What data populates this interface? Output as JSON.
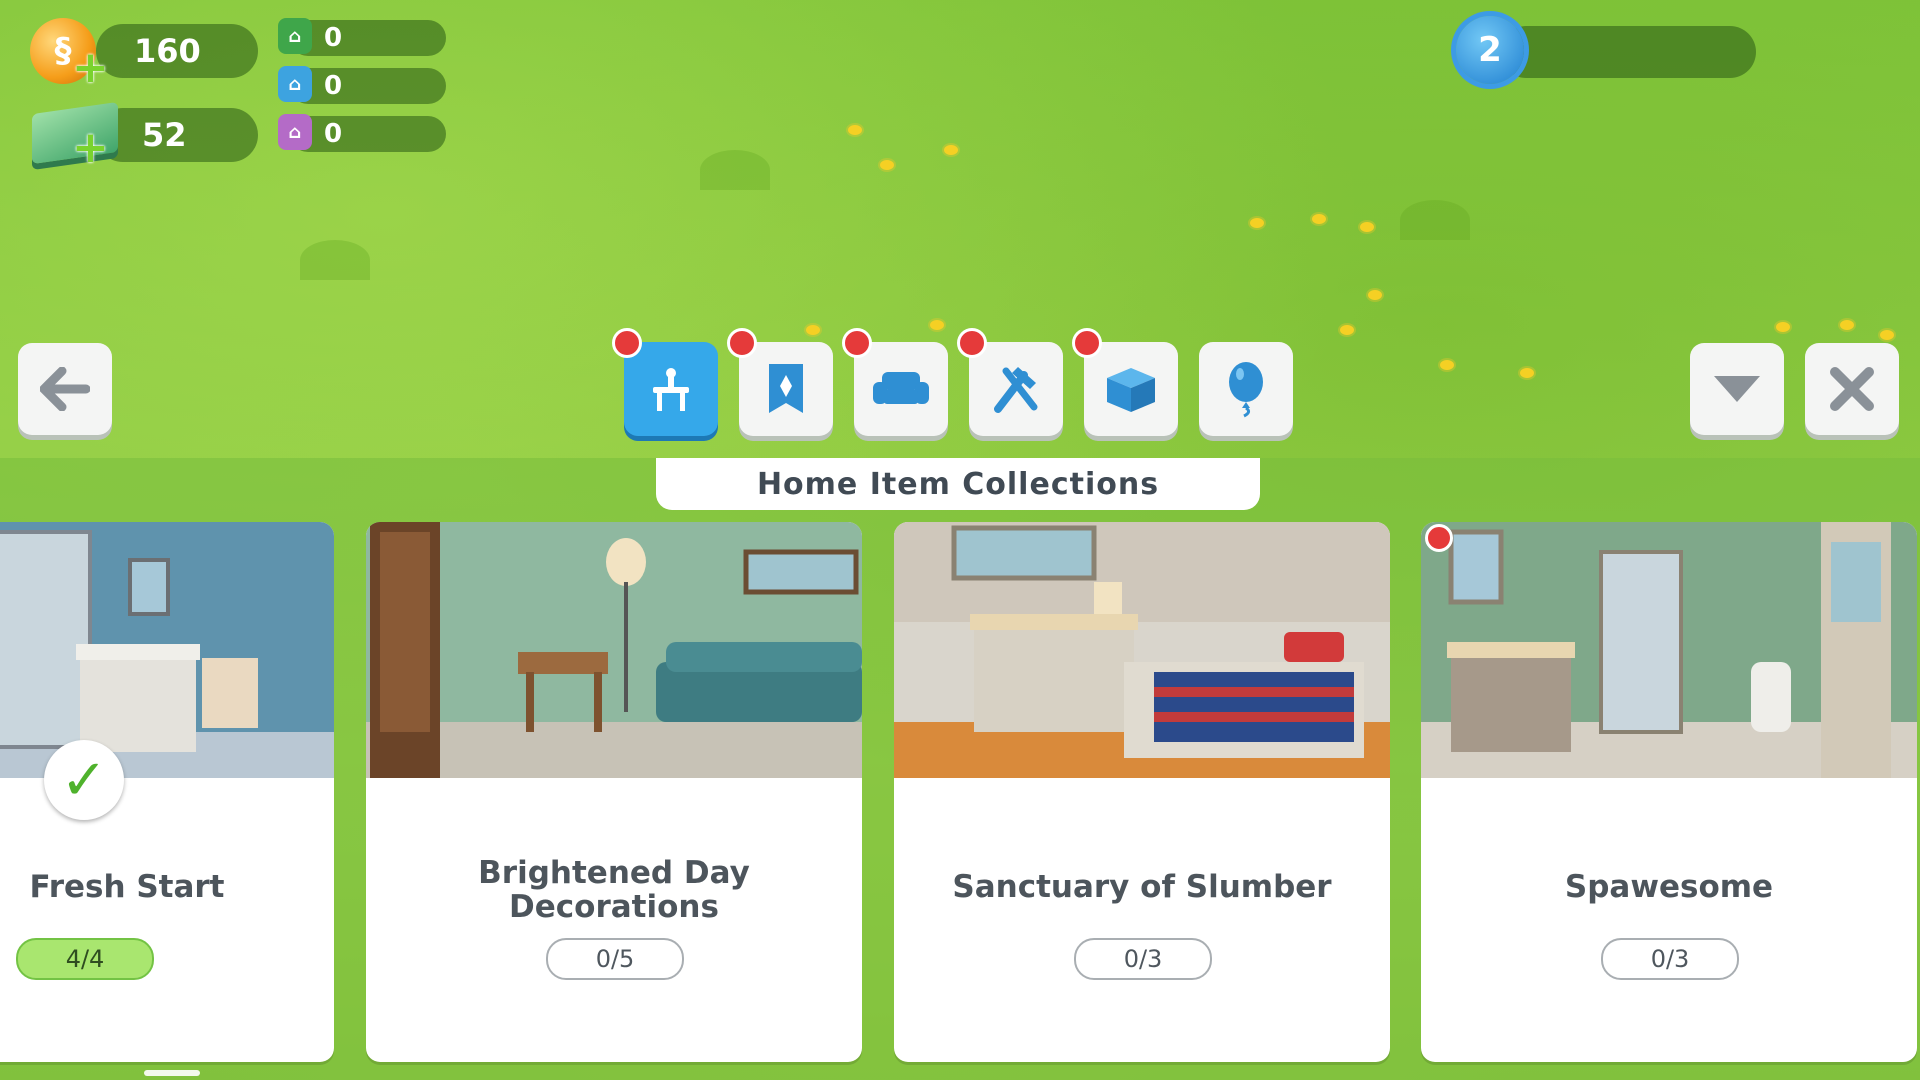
{
  "hud": {
    "simoleons": "160",
    "simcash": "52",
    "green_tokens": "0",
    "blue_tokens": "0",
    "purple_tokens": "0",
    "level": "2",
    "colors": {
      "green_token": "#3fa64a",
      "blue_token": "#3da3e0",
      "purple_token": "#b46bc7"
    }
  },
  "toolbar": {
    "tabs": [
      {
        "icon": "table-icon",
        "active": true,
        "notification": true
      },
      {
        "icon": "bookmark-icon",
        "active": false,
        "notification": true
      },
      {
        "icon": "armchair-icon",
        "active": false,
        "notification": true
      },
      {
        "icon": "tools-icon",
        "active": false,
        "notification": true
      },
      {
        "icon": "box-icon",
        "active": false,
        "notification": true
      },
      {
        "icon": "balloon-icon",
        "active": false,
        "notification": false
      }
    ]
  },
  "panel": {
    "title": "Home Item Collections",
    "collections": [
      {
        "name": "Fresh Start",
        "progress": "4/4",
        "completed": true
      },
      {
        "name": "Brightened Day Decorations",
        "line1": "Brightened Day",
        "line2": "Decorations",
        "progress": "0/5",
        "completed": false
      },
      {
        "name": "Sanctuary of Slumber",
        "progress": "0/3",
        "completed": false
      },
      {
        "name": "Spawesome",
        "progress": "0/3",
        "completed": false,
        "notification": true
      }
    ]
  },
  "accent_color": "#35a8ea"
}
